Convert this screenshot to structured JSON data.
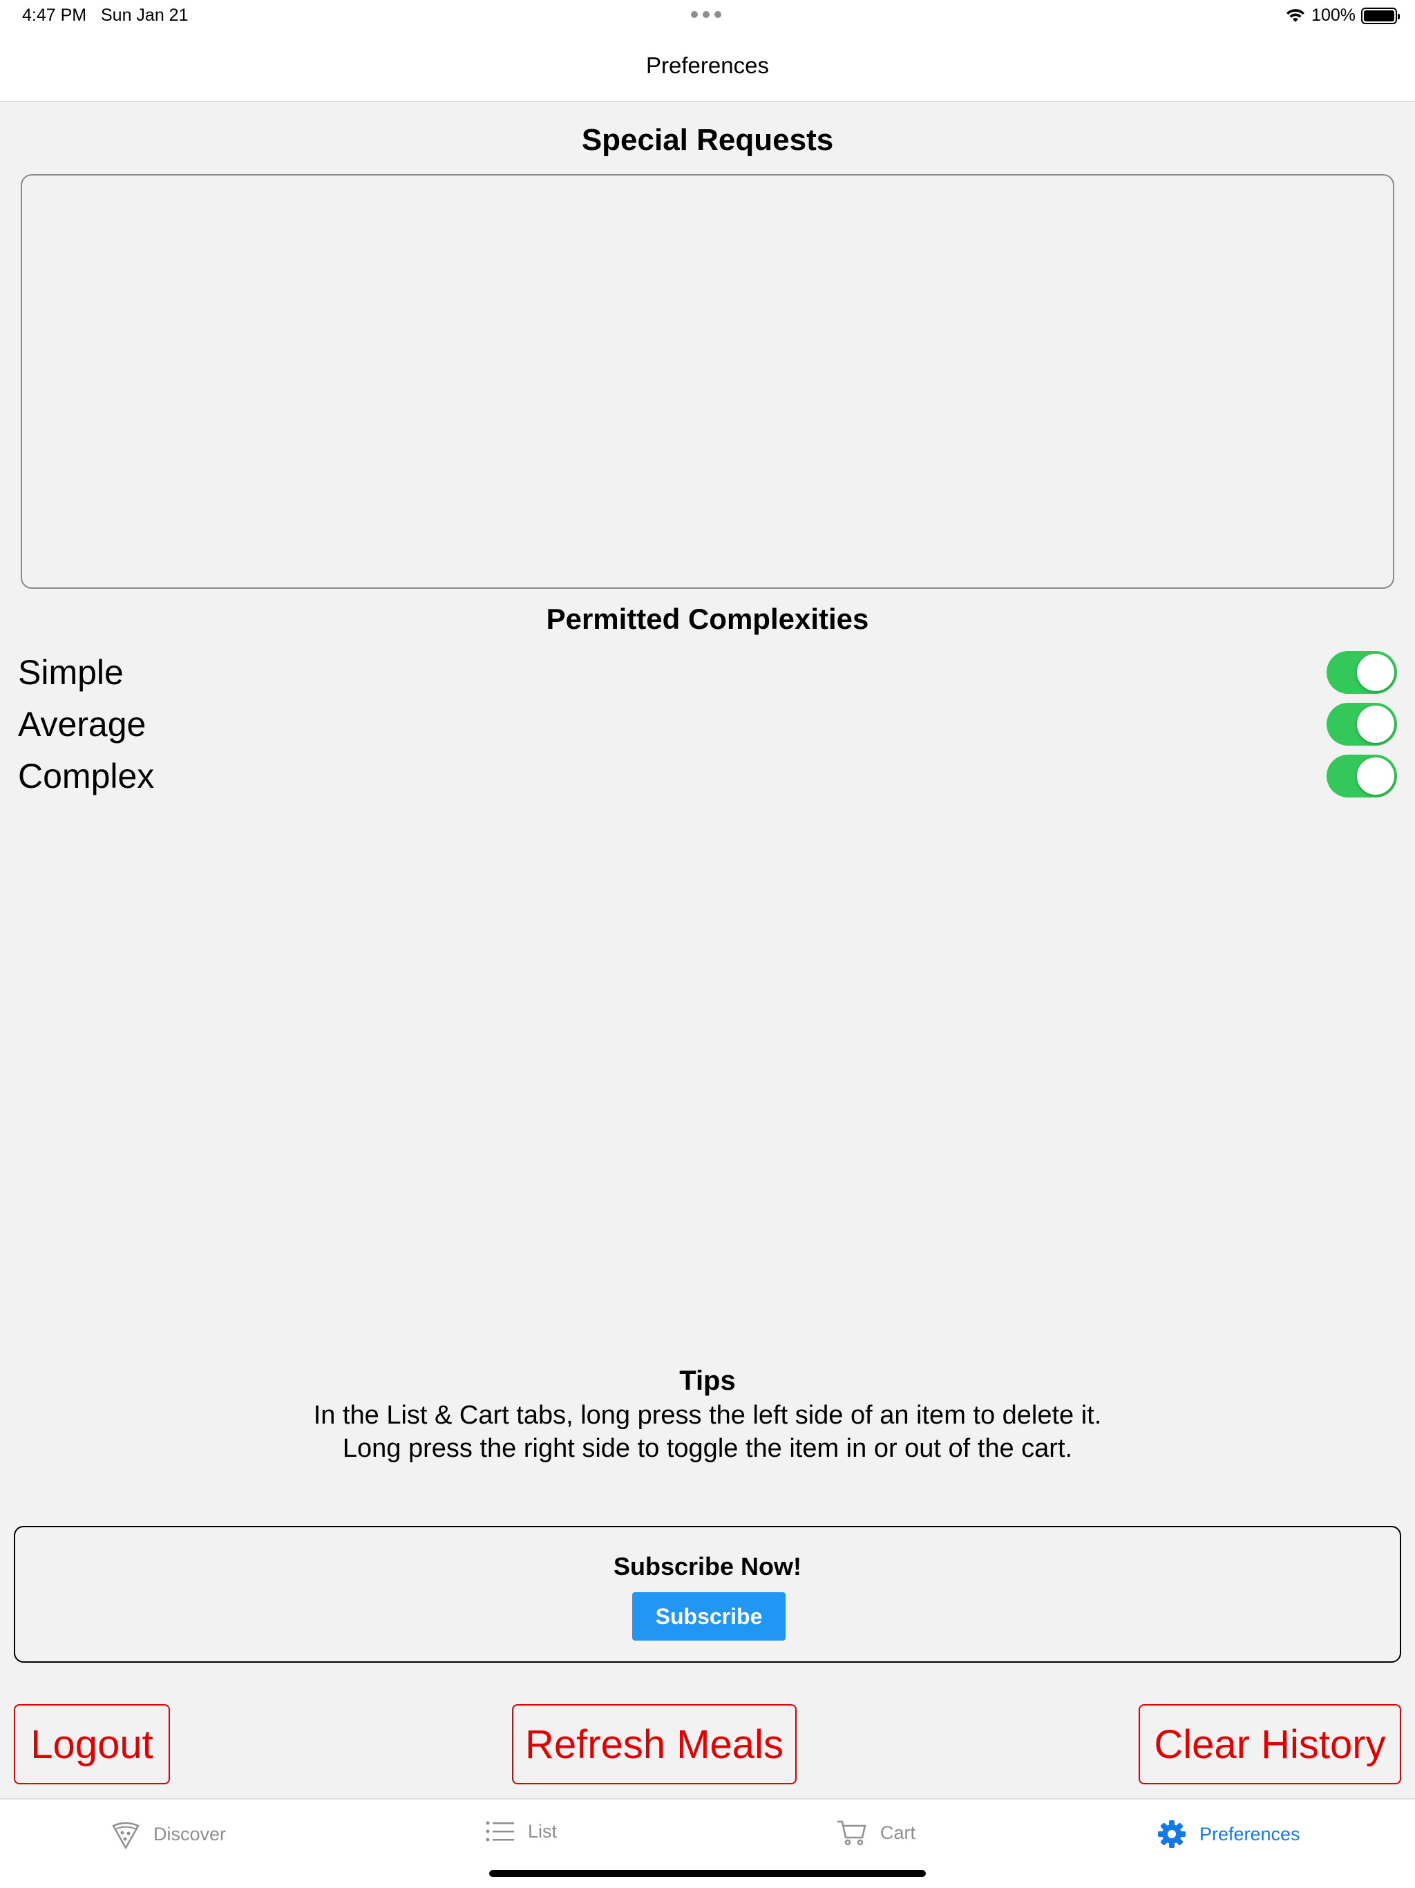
{
  "status_bar": {
    "time": "4:47 PM",
    "date": "Sun Jan 21",
    "battery": "100%"
  },
  "nav": {
    "title": "Preferences"
  },
  "special_requests": {
    "title": "Special Requests",
    "value": ""
  },
  "complexities": {
    "title": "Permitted Complexities",
    "items": [
      {
        "label": "Simple",
        "enabled": true
      },
      {
        "label": "Average",
        "enabled": true
      },
      {
        "label": "Complex",
        "enabled": true
      }
    ]
  },
  "tips": {
    "title": "Tips",
    "lines": [
      "In the List & Cart tabs, long press the left side of an item to delete it.",
      "Long press the right side to toggle the item in or out of the cart."
    ]
  },
  "subscribe": {
    "title": "Subscribe Now!",
    "button": "Subscribe"
  },
  "actions": {
    "logout": "Logout",
    "refresh": "Refresh Meals",
    "clear": "Clear History"
  },
  "tabs": [
    {
      "label": "Discover",
      "icon": "pizza-icon",
      "active": false
    },
    {
      "label": "List",
      "icon": "list-icon",
      "active": false
    },
    {
      "label": "Cart",
      "icon": "cart-icon",
      "active": false
    },
    {
      "label": "Preferences",
      "icon": "gear-icon",
      "active": true
    }
  ],
  "colors": {
    "accent": "#1479e6",
    "toggle_on": "#34c759",
    "danger": "#e00000",
    "subscribe": "#2196f3"
  }
}
